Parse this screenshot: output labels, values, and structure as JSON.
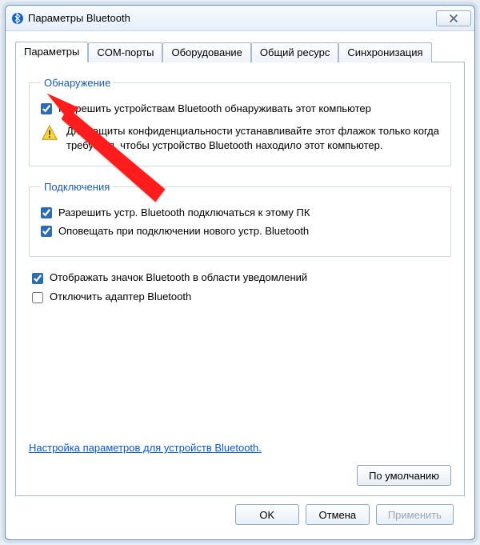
{
  "window": {
    "title": "Параметры Bluetooth"
  },
  "tabs": {
    "t0": "Параметры",
    "t1": "COM-порты",
    "t2": "Оборудование",
    "t3": "Общий ресурс",
    "t4": "Синхронизация"
  },
  "discovery": {
    "legend": "Обнаружение",
    "allow_label": "Разрешить устройствам Bluetooth обнаруживать этот компьютер",
    "warn_text": "Для защиты конфиденциальности устанавливайте этот флажок только когда требуется, чтобы устройство Bluetooth находило этот компьютер."
  },
  "connections": {
    "legend": "Подключения",
    "allow_connect_label": "Разрешить устр. Bluetooth подключаться к этому ПК",
    "notify_label": "Оповещать при подключении нового устр. Bluetooth"
  },
  "misc": {
    "show_tray_label": "Отображать значок Bluetooth в области уведомлений",
    "disable_adapter_label": "Отключить адаптер Bluetooth"
  },
  "links": {
    "configure": "Настройка параметров для устройств Bluetooth."
  },
  "buttons": {
    "defaults": "По умолчанию",
    "ok": "OK",
    "cancel": "Отмена",
    "apply": "Применить"
  }
}
